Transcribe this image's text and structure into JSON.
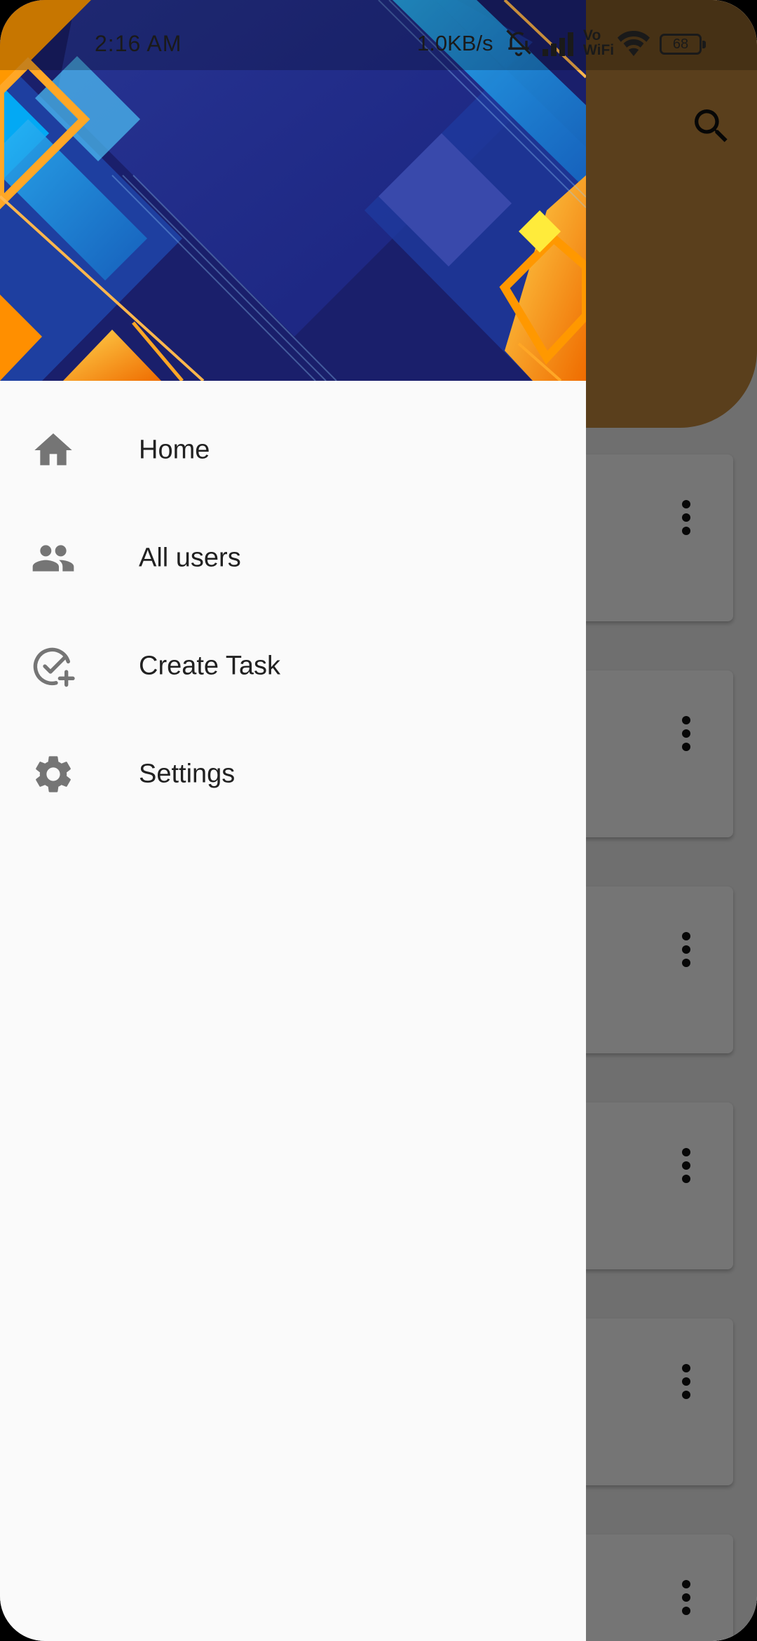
{
  "status_bar": {
    "time": "2:16 AM",
    "network_speed": "1.0KB/s",
    "vowifi_line1": "Vo",
    "vowifi_line2": "WiFi",
    "battery": "68"
  },
  "drawer": {
    "items": [
      {
        "label": "Home",
        "icon": "home-icon"
      },
      {
        "label": "All users",
        "icon": "people-icon"
      },
      {
        "label": "Create Task",
        "icon": "task-add-icon"
      },
      {
        "label": "Settings",
        "icon": "gear-icon"
      }
    ]
  },
  "app": {
    "header_color": "#c58a3d",
    "search_icon": "search-icon",
    "card_menu_icon": "more-vert-icon"
  },
  "colors": {
    "drawer_bg": "#fafafa",
    "icon_grey": "#757575",
    "text_dark": "#212121",
    "scrim": "rgba(0,0,0,0.54)"
  }
}
